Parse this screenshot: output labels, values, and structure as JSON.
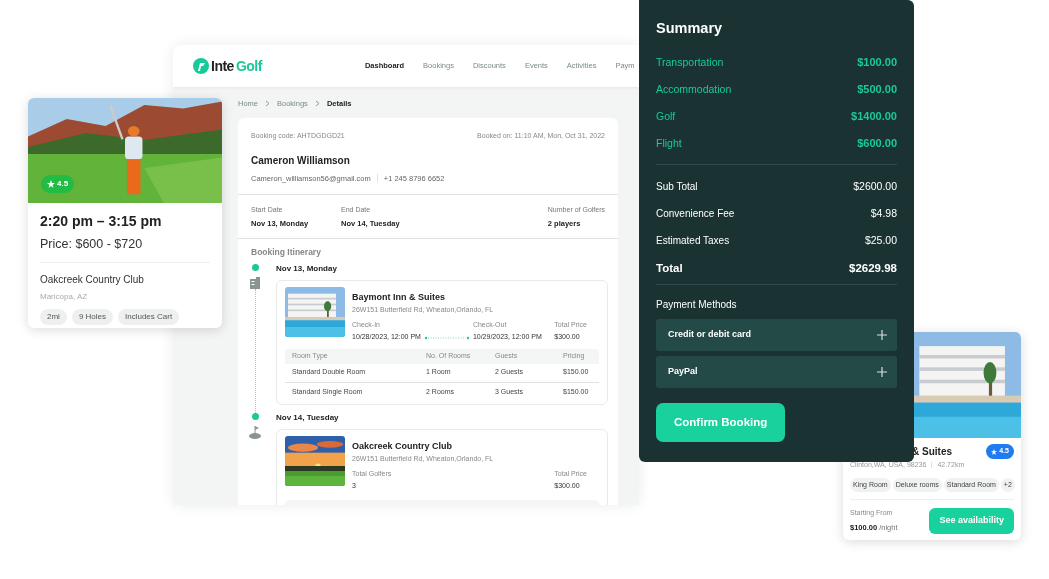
{
  "dashboard": {
    "logo_words": [
      "Inte",
      "Golf"
    ],
    "nav": [
      {
        "label": "Dashboard",
        "selected": true
      },
      {
        "label": "Bookings",
        "selected": false
      },
      {
        "label": "Discounts",
        "selected": false
      },
      {
        "label": "Events",
        "selected": false
      },
      {
        "label": "Activities",
        "selected": false
      },
      {
        "label": "Paym",
        "selected": false
      }
    ],
    "breadcrumb": [
      "Home",
      "Bookings",
      "Details"
    ],
    "booking": {
      "code": "Booking code: AHTDGDGD21",
      "booked_on": "Booked on: 11:10 AM, Mon, Oct 31, 2022",
      "customer": "Cameron Williamson",
      "email": "Cameron_williamson56@gmail.com",
      "phone": "+1 245 8796 6652",
      "facts": [
        {
          "label": "Start Date",
          "value": "Nov 13, Monday"
        },
        {
          "label": "End Date",
          "value": "Nov 14, Tuesday"
        },
        {
          "label": "Number of Golfers",
          "value": "2 players"
        }
      ],
      "itinerary_title": "Booking Itinerary",
      "itinerary": [
        {
          "kind": "hotel",
          "date": "Nov 13, Monday",
          "name": "Baymont Inn & Suites",
          "address": "26W151 Butterfield Rd, Wheaton,Orlando, FL",
          "check_in_label": "Check-In",
          "check_in": "10/28/2023, 12:00 PM",
          "check_out_label": "Check-Out",
          "check_out": "10/29/2023, 12:00 PM",
          "price_label": "Total Price",
          "price": "$300.00",
          "columns": [
            "Room Type",
            "No. Of Rooms",
            "Guests",
            "Pricing"
          ],
          "rows": [
            [
              "Standard Double Room",
              "1 Room",
              "2 Guests",
              "$150.00"
            ],
            [
              "Standard Single Room",
              "2 Rooms",
              "3 Guests",
              "$150.00"
            ]
          ]
        },
        {
          "kind": "golf",
          "date": "Nov 14, Tuesday",
          "name": "Oakcreek Country Club",
          "address": "26W151 Butterfield Rd, Wheaton,Orlando, FL",
          "golfers_label": "Total Golfers",
          "golfers": "3",
          "price_label": "Total Price",
          "price": "$300.00"
        }
      ]
    }
  },
  "tee_time_card": {
    "rating": "4.5",
    "time": "2:20 pm – 3:15 pm",
    "price": "Price: $600 - $720",
    "club": "Oakcreek Country Club",
    "location": "Maricopa, AZ",
    "tags": [
      "2mi",
      "9 Holes",
      "Includes Cart"
    ]
  },
  "summary": {
    "title": "Summary",
    "items": [
      {
        "label": "Transportation",
        "amount": "$100.00"
      },
      {
        "label": "Accommodation",
        "amount": "$500.00"
      },
      {
        "label": "Golf",
        "amount": "$1400.00"
      },
      {
        "label": "Flight",
        "amount": "$600.00"
      }
    ],
    "totals": [
      {
        "label": "Sub Total",
        "amount": "$2600.00",
        "bold": false
      },
      {
        "label": "Convenience Fee",
        "amount": "$4.98",
        "bold": false
      },
      {
        "label": "Estimated Taxes",
        "amount": "$25.00",
        "bold": false
      },
      {
        "label": "Total",
        "amount": "$2629.98",
        "bold": true
      }
    ],
    "payment_title": "Payment Methods",
    "payment_methods": [
      {
        "label": "Credit or debit card",
        "expanded": false
      },
      {
        "label": "PayPal",
        "expanded": false
      }
    ],
    "confirm": "Confirm Booking"
  },
  "hotel_card": {
    "name": "& Suites",
    "rating": "4.5",
    "location": "Clinton,WA, USA, 98236",
    "distance": "42.72km",
    "tags": [
      "King Room",
      "Deluxe rooms",
      "Standard Room",
      "+2"
    ],
    "price_label": "Starting From",
    "price": "$100.00",
    "per": "/night",
    "action": "See availability"
  }
}
